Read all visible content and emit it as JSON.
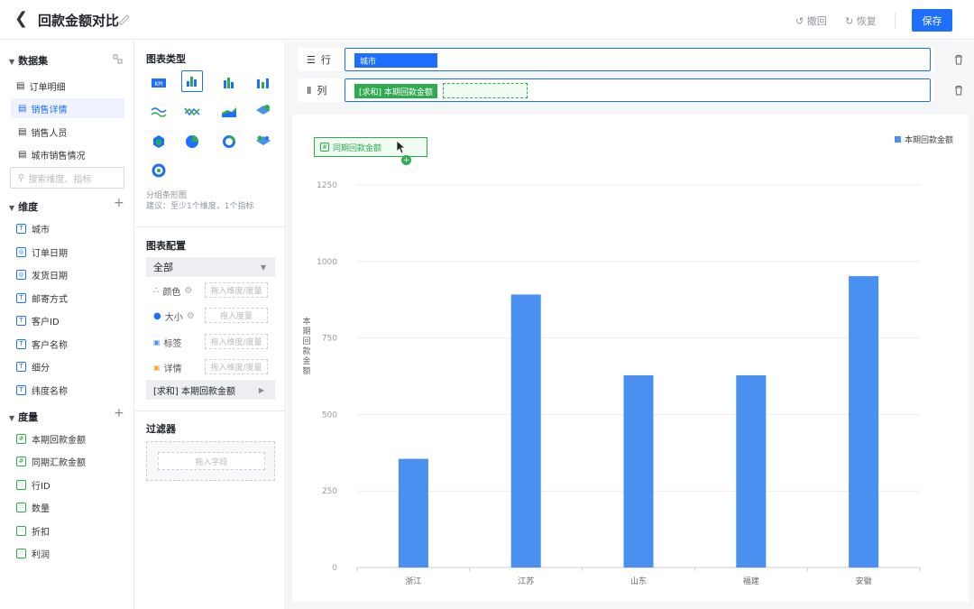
{
  "header": {
    "title": "回款金额对比",
    "undo": "撤回",
    "redo": "恢复",
    "save": "保存"
  },
  "dataset": {
    "title": "数据集",
    "items": [
      {
        "label": "订单明细"
      },
      {
        "label": "销售详情",
        "selected": true
      },
      {
        "label": "销售人员"
      },
      {
        "label": "城市销售情况"
      }
    ]
  },
  "search": {
    "placeholder": "搜索维度、指标"
  },
  "dimensions": {
    "title": "维度",
    "items": [
      {
        "label": "城市",
        "icon": "T"
      },
      {
        "label": "订单日期",
        "icon": "date"
      },
      {
        "label": "发货日期",
        "icon": "date"
      },
      {
        "label": "邮寄方式",
        "icon": "T"
      },
      {
        "label": "客户ID",
        "icon": "T"
      },
      {
        "label": "客户名称",
        "icon": "T"
      },
      {
        "label": "细分",
        "icon": "T"
      },
      {
        "label": "纬度名称",
        "icon": "T"
      }
    ]
  },
  "measures": {
    "title": "度量",
    "items": [
      {
        "label": "本期回款金额",
        "icon": "#"
      },
      {
        "label": "同期汇款金额",
        "icon": "#"
      },
      {
        "label": "行ID",
        "icon": "num"
      },
      {
        "label": "数量",
        "icon": "num"
      },
      {
        "label": "折扣",
        "icon": "num"
      },
      {
        "label": "利润",
        "icon": "num"
      }
    ]
  },
  "chart_types": {
    "title": "图表类型",
    "hint1": "分组条形图",
    "hint2": "建议：至少1个维度，1个指标"
  },
  "chart_config": {
    "title": "图表配置",
    "all": "全部",
    "rows": [
      {
        "label": "颜色",
        "placeholder": "拖入维度/度量"
      },
      {
        "label": "大小",
        "placeholder": "拖入度量"
      },
      {
        "label": "标签",
        "placeholder": "拖入维度/度量"
      },
      {
        "label": "详情",
        "placeholder": "拖入维度/度量"
      }
    ],
    "measure_bar": "[求和] 本期回款金额"
  },
  "filter": {
    "title": "过滤器",
    "placeholder": "拖入字段"
  },
  "shelves": {
    "row_label": "行",
    "col_label": "列",
    "row_pill": "城市",
    "col_pill": "[求和] 本期回款金额"
  },
  "drag_ghost": {
    "label": "同期回款金额"
  },
  "colors": {
    "primary": "#1f6fff",
    "bar": "#4a90f0",
    "green": "#2eaa4f"
  },
  "chart_data": {
    "type": "bar",
    "categories": [
      "浙江",
      "江苏",
      "山东",
      "福建",
      "安徽"
    ],
    "series": [
      {
        "name": "本期回款金额",
        "values": [
          355,
          892,
          628,
          628,
          952
        ]
      }
    ],
    "ylabel": "本期回款金额",
    "ylim": [
      0,
      1250
    ],
    "yticks": [
      0,
      250,
      500,
      750,
      1000,
      1250
    ],
    "legend": "top-right",
    "grid": true
  }
}
